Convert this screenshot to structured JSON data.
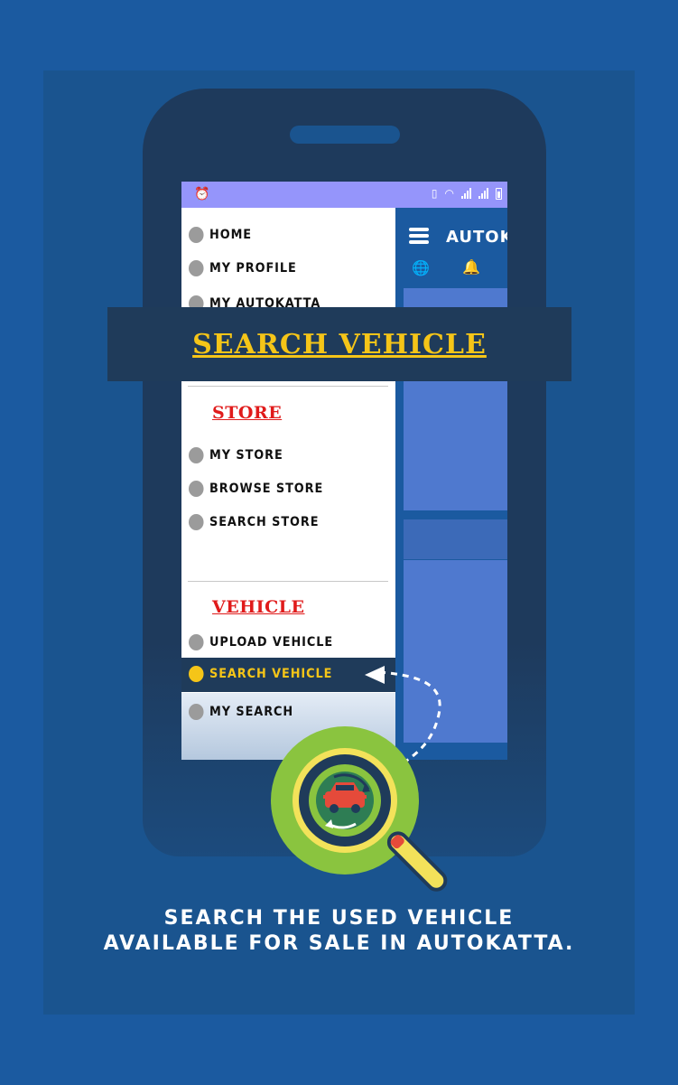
{
  "status_bar": {
    "left_icon": "alarm-icon",
    "right_icons": [
      "vibrate-icon",
      "wifi-icon",
      "signal-icon",
      "signal-icon",
      "battery-icon"
    ]
  },
  "toolbar": {
    "app_title": "AUTOK",
    "menu_icon": "hamburger-icon",
    "icons": [
      "globe-icon",
      "bell-icon"
    ]
  },
  "drawer": {
    "top_items": [
      {
        "label": "HOME"
      },
      {
        "label": "MY PROFILE"
      },
      {
        "label": "MY AUTOKATTA"
      }
    ],
    "store": {
      "title": "STORE",
      "items": [
        {
          "label": "MY STORE"
        },
        {
          "label": "BROWSE STORE"
        },
        {
          "label": "SEARCH STORE"
        }
      ]
    },
    "vehicle": {
      "title": "VEHICLE",
      "items": [
        {
          "label": "UPLOAD VEHICLE",
          "active": false
        },
        {
          "label": "SEARCH VEHICLE",
          "active": true
        },
        {
          "label": "MY SEARCH",
          "active": false
        }
      ]
    }
  },
  "banner": {
    "title": "SEARCH VEHICLE"
  },
  "caption": {
    "line1": "SEARCH THE USED VEHICLE",
    "line2": "AVAILABLE FOR SALE IN AUTOKATTA."
  },
  "colors": {
    "background": "#1b5aa0",
    "accent": "#f5c518",
    "section_title": "#e01b1b",
    "banner_bg": "#1f3b5a",
    "status_bar": "#9595fb"
  }
}
